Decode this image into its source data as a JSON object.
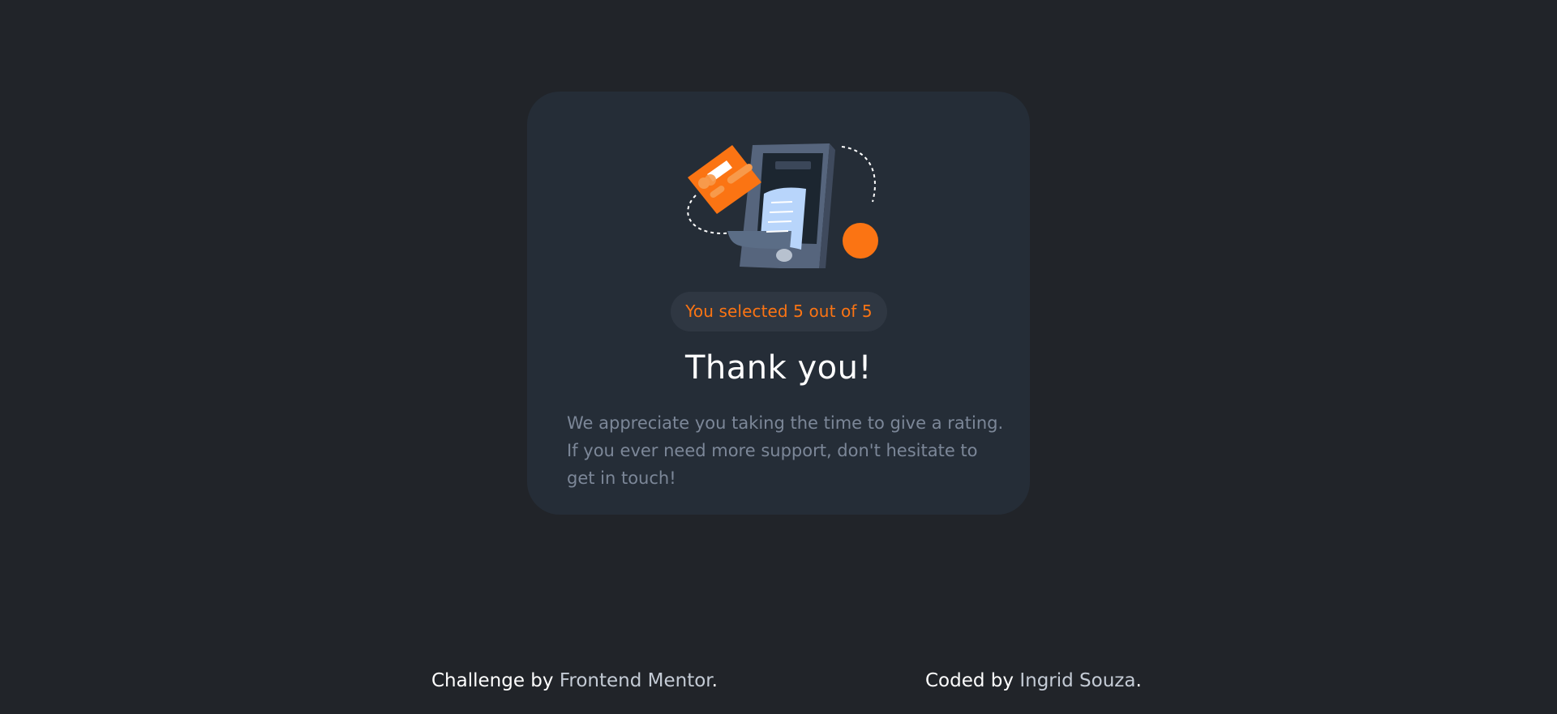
{
  "card": {
    "selection_text": "You selected 5 out of 5",
    "title": "Thank you!",
    "message": "We appreciate you taking the time to give a rating. If you ever need more support, don't hesitate to get in touch!",
    "illustration_icon": "phone-payment-receipt-illustration"
  },
  "footer": {
    "challenge_prefix": "Challenge by ",
    "challenge_link": "Frontend Mentor",
    "challenge_suffix": ".",
    "coded_prefix": "Coded by ",
    "coded_link": "Ingrid Souza",
    "coded_suffix": "."
  },
  "colors": {
    "page_background": "#212429",
    "card_background": "#252d37",
    "accent_orange": "#fb7413",
    "muted_text": "#7c8798"
  }
}
